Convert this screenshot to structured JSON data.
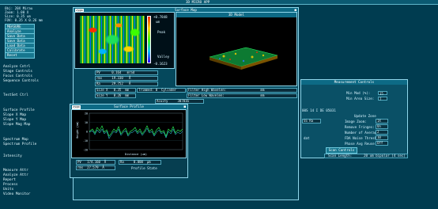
{
  "top_title": "3D MICRO APP",
  "left_info": [
    {
      "label": "Obj:",
      "value": "20X",
      "extra": "Mirau"
    },
    {
      "label": "Zoom:",
      "value": "1.00 X"
    },
    {
      "label": "Size:",
      "value": "0.35 um"
    },
    {
      "label": "FOV:",
      "value": "0.35 X 0.26 mm"
    }
  ],
  "left_buttons": [
    "MEASURE",
    "Analyze",
    "Save Data",
    "Save Data",
    "Load Data",
    "Calibrate",
    "Reset"
  ],
  "left_menu_1": [
    "Analyze Cntrl",
    "Stage Controls",
    "Focus Controls",
    "Sequence Controls"
  ],
  "left_menu_2": [
    "TestSet Ctrl"
  ],
  "left_menu_3": [
    "Surface Profile",
    "Slope X Map",
    "Slope Y Map",
    "Slope Mag Map"
  ],
  "left_menu_4": [
    "Spectrum Map",
    "Spectrum Profile"
  ],
  "left_menu_5": [
    "Intensity"
  ],
  "left_menu_6": [
    "Measure Attr",
    "Analyze Attr",
    "Report",
    "Process",
    "Units",
    "Video Monitor"
  ],
  "surface_map": {
    "title": "Surface Map",
    "zygo": "zygo",
    "scale_top": "+0.7848",
    "scale_bottom": "-0.1623",
    "scale_unit": "um",
    "peak_label": "Peak",
    "valley_label": "Valley",
    "stats": [
      {
        "label": "PV",
        "value": "0.164",
        "unit": "mrad"
      },
      {
        "label": "rms",
        "value": "19.330",
        "unit": "Å"
      },
      {
        "label": "Ra",
        "value": "29.752",
        "unit": "Å"
      }
    ],
    "size_x_label": "Size X",
    "size_x_value": "0.35",
    "size_x_unit": "mm",
    "size_y_label": "Size Y",
    "size_y_value": "0.26",
    "size_y_unit": "mm",
    "trimmed_label": "Trimmed:",
    "trimmed_value": "0",
    "trimmed_unit": "Cylinder",
    "filter_high_label": "Filter High Wavelen:",
    "filter_high_unit": "mm",
    "filter_low_label": "Filter Low Wavelen:",
    "filter_low_unit": "mm",
    "acuity_label": "Acuity",
    "acuity_value": "307016"
  },
  "model_3d": {
    "title": "3D Model"
  },
  "surface_profile": {
    "title": "Surface Profile",
    "zygo": "zygo",
    "ylabel": "Height (nm)",
    "xlabel": "Distance (um)",
    "y_ticks": [
      "20",
      "10",
      "0",
      "-10",
      "-20"
    ],
    "stats": [
      {
        "label": "PV",
        "value": "174.160",
        "unit": "Å"
      },
      {
        "label": "rms",
        "value": "27.579",
        "unit": "Å"
      }
    ],
    "ra_label": "Ra",
    "ra_value": "0.000",
    "ra_unit": "μm",
    "state_label": "Profile State"
  },
  "measurement_controls": {
    "title": "Measurement Controls",
    "min_mod_label": "Min Mod (%):",
    "min_mod_value": "15",
    "min_area_label": "Min Area Size:",
    "min_area_value": "7",
    "serial_text": "00S 14 I DE 05031",
    "update_zone_label": "Update Zone",
    "stage_label": "SS Ra",
    "rows": [
      {
        "label": "Image Zoom:",
        "value": "1X"
      },
      {
        "label": "Remove Fringes:",
        "value": "On"
      },
      {
        "label": "Number of Averages:",
        "value": "2"
      },
      {
        "label": "FDA Noise Threshold:",
        "value": "10"
      },
      {
        "label": "Phase Avg Reuse:",
        "value": "Off"
      }
    ],
    "scan_controls": "Scan Controls",
    "scan_length_label": "Scan Length:",
    "scan_length_value": "20 um bipolar (4 sec)",
    "dat_label": "dat"
  }
}
